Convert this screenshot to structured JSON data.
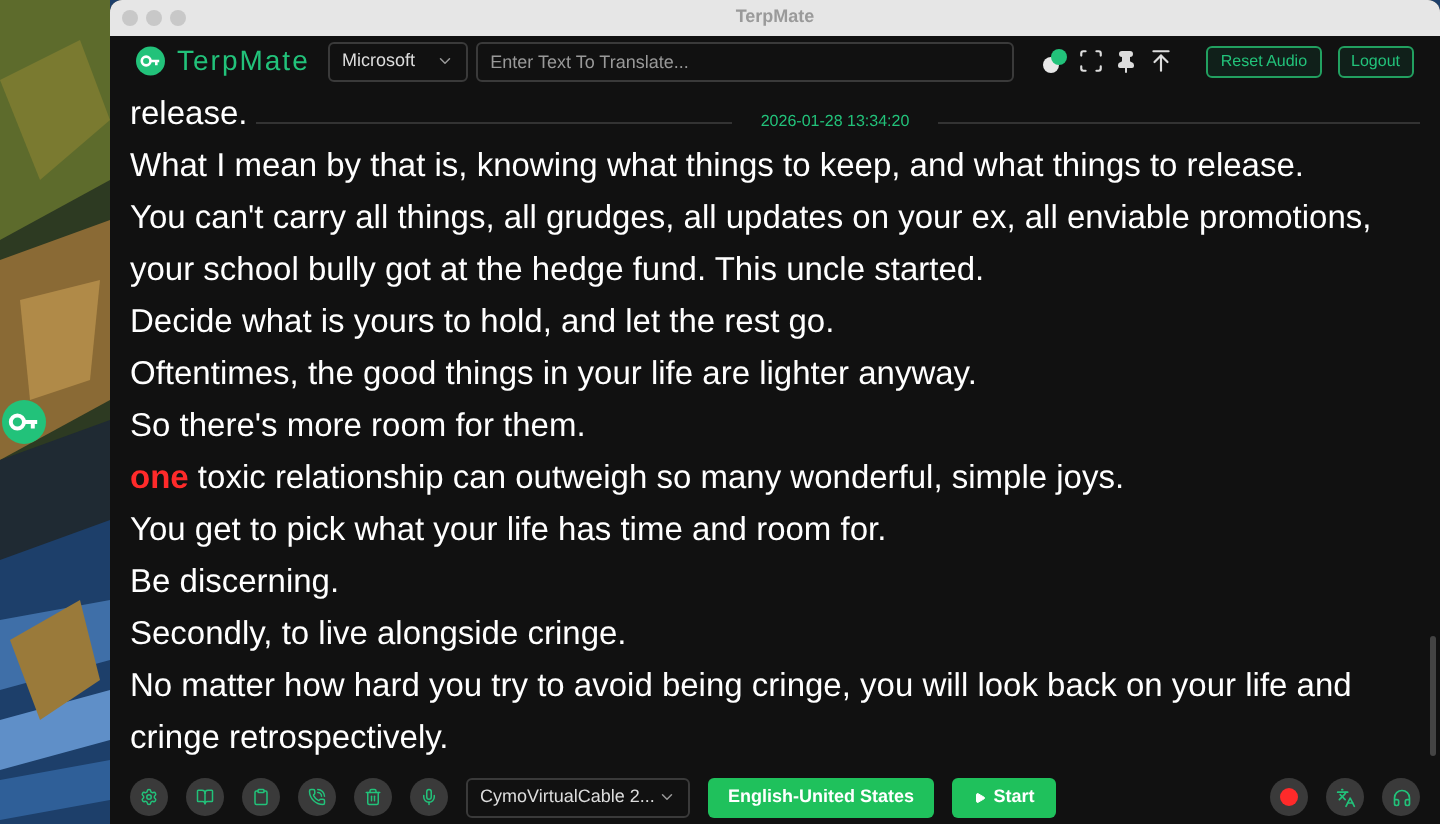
{
  "window": {
    "title": "TerpMate"
  },
  "header": {
    "app_name": "TerpMate",
    "engine": "Microsoft",
    "translate_field": {
      "placeholder": "Enter Text To Translate..."
    },
    "toggle_on": true,
    "buttons": [
      "Reset Audio",
      "Logout"
    ]
  },
  "transcript": {
    "timestamp": "2026-01-28 13:34:20",
    "lines": [
      {
        "parts": [
          {
            "text": "release."
          }
        ]
      },
      {
        "parts": [
          {
            "text": "What I mean by that is, knowing what things to keep, and what things to release."
          }
        ]
      },
      {
        "parts": [
          {
            "text": "You can't carry all things, all grudges, all updates on your ex, all enviable promotions, your school bully got at the hedge fund. This uncle started."
          }
        ]
      },
      {
        "parts": [
          {
            "text": "Decide what is yours to hold, and let the rest go."
          }
        ]
      },
      {
        "parts": [
          {
            "text": "Oftentimes, the good things in your life are lighter anyway."
          }
        ]
      },
      {
        "parts": [
          {
            "text": "So there's more room for them."
          }
        ]
      },
      {
        "parts": [
          {
            "text": "one",
            "kind": "highlight"
          },
          {
            "text": " toxic relationship can outweigh so many wonderful, simple joys."
          }
        ]
      },
      {
        "parts": [
          {
            "text": "You get to pick what your life has time and room for."
          }
        ]
      },
      {
        "parts": [
          {
            "text": "Be discerning."
          }
        ]
      },
      {
        "parts": [
          {
            "text": "Secondly, to live alongside cringe."
          }
        ]
      },
      {
        "parts": [
          {
            "text": "No matter how hard you try to avoid being cringe, you will look back on your life and cringe retrospectively."
          }
        ]
      }
    ]
  },
  "footer": {
    "audio_device": "CymoVirtualCable 2...",
    "language": "English-United States",
    "start_button": "Start",
    "recording": true
  }
}
